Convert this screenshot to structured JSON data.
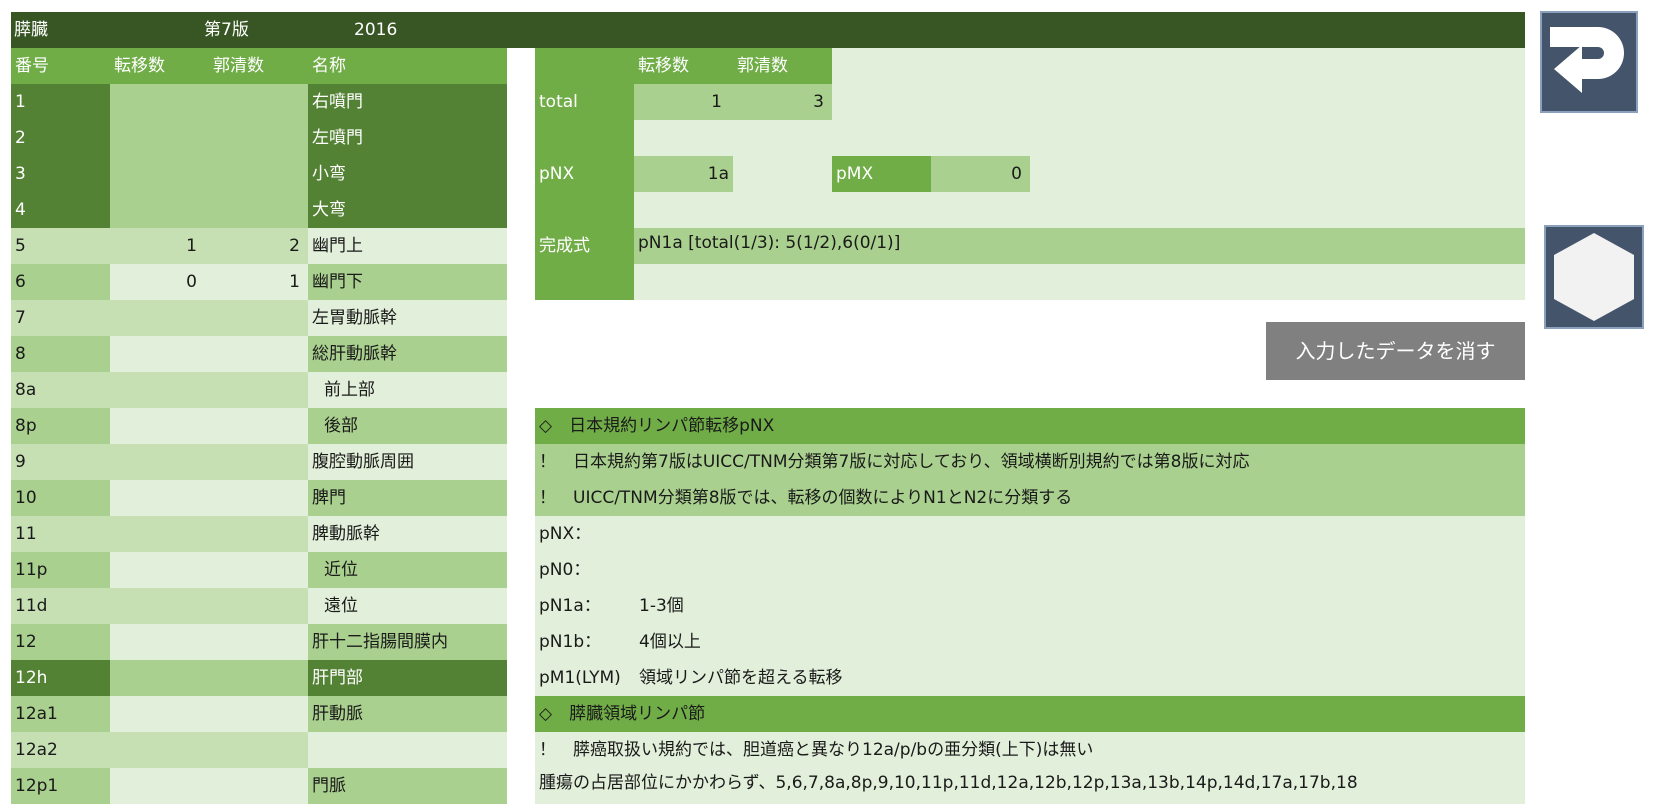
{
  "header": {
    "organ": "膵臓",
    "edition": "第7版",
    "year": "2016"
  },
  "left_table": {
    "columns": [
      "番号",
      "転移数",
      "郭清数",
      "名称"
    ],
    "rows": [
      {
        "no": "1",
        "meta": "",
        "dissect": "",
        "name": "右噴門"
      },
      {
        "no": "2",
        "meta": "",
        "dissect": "",
        "name": "左噴門"
      },
      {
        "no": "3",
        "meta": "",
        "dissect": "",
        "name": "小弯"
      },
      {
        "no": "4",
        "meta": "",
        "dissect": "",
        "name": "大弯"
      },
      {
        "no": "5",
        "meta": "1",
        "dissect": "2",
        "name": "幽門上"
      },
      {
        "no": "6",
        "meta": "0",
        "dissect": "1",
        "name": "幽門下"
      },
      {
        "no": "7",
        "meta": "",
        "dissect": "",
        "name": "左胃動脈幹"
      },
      {
        "no": "8",
        "meta": "",
        "dissect": "",
        "name": "総肝動脈幹"
      },
      {
        "no": "8a",
        "meta": "",
        "dissect": "",
        "name": "前上部"
      },
      {
        "no": "8p",
        "meta": "",
        "dissect": "",
        "name": "後部"
      },
      {
        "no": "9",
        "meta": "",
        "dissect": "",
        "name": "腹腔動脈周囲"
      },
      {
        "no": "10",
        "meta": "",
        "dissect": "",
        "name": "脾門"
      },
      {
        "no": "11",
        "meta": "",
        "dissect": "",
        "name": "脾動脈幹"
      },
      {
        "no": "11p",
        "meta": "",
        "dissect": "",
        "name": "近位"
      },
      {
        "no": "11d",
        "meta": "",
        "dissect": "",
        "name": "遠位"
      },
      {
        "no": "12",
        "meta": "",
        "dissect": "",
        "name": "肝十二指腸間膜内"
      },
      {
        "no": "12h",
        "meta": "",
        "dissect": "",
        "name": "肝門部"
      },
      {
        "no": "12a1",
        "meta": "",
        "dissect": "",
        "name": "肝動脈"
      },
      {
        "no": "12a2",
        "meta": "",
        "dissect": "",
        "name": ""
      },
      {
        "no": "12p1",
        "meta": "",
        "dissect": "",
        "name": "門脈"
      }
    ]
  },
  "summary": {
    "col_meta": "転移数",
    "col_dissect": "郭清数",
    "total_label": "total",
    "total_meta": "1",
    "total_dissect": "3",
    "pnx_label": "pNX",
    "pnx_value": "1a",
    "pmx_label": "pMX",
    "pmx_value": "0",
    "formula_label": "完成式",
    "formula_value": "pN1a [total(1/3): 5(1/2),6(0/1)]"
  },
  "clear_button_label": "入力したデータを消す",
  "notes": {
    "section1_title": "◇　日本規約リンパ節転移pNX",
    "note1": "！　日本規約第7版はUICC/TNM分類第7版に対応しており、領域横断別規約では第8版に対応",
    "note2": "！　UICC/TNM分類第8版では、転移の個数によりN1とN2に分類する",
    "definitions": [
      {
        "term": "pNX：",
        "desc": ""
      },
      {
        "term": "pN0：",
        "desc": ""
      },
      {
        "term": "pN1a：",
        "desc": "1-3個"
      },
      {
        "term": "pN1b：",
        "desc": "4個以上"
      },
      {
        "term": "pM1(LYM)",
        "desc": "領域リンパ節を超える転移"
      }
    ],
    "section2_title": "◇　膵臓領域リンパ節",
    "note3": "！　膵癌取扱い規約では、胆道癌と異なり12a/p/bの亜分類(上下)は無い",
    "note4": "腫瘍の占居部位にかかわらず、5,6,7,8a,8p,9,10,11p,11d,12a,12b,12p,13a,13b,14p,14d,17a,17b,18"
  },
  "colors": {
    "dark_header": "#375623",
    "dark_green": "#548235",
    "green": "#70ad47",
    "medium": "#a9d08e",
    "light": "#c6e0b4",
    "lightest": "#e2efda",
    "button_gray": "#808080",
    "icon_bg": "#44546a"
  },
  "icons": {
    "return": "return-arrow-icon",
    "hexagon": "hexagon-icon"
  }
}
